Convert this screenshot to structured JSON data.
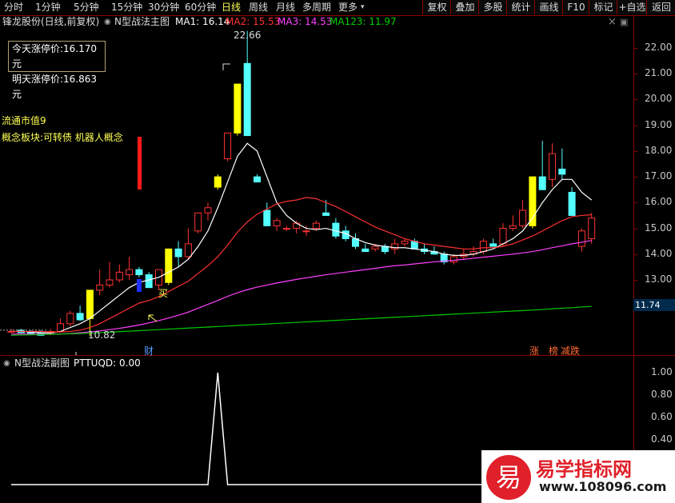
{
  "stock_title": "锋龙股份(日线,前复权)",
  "period_tabs": [
    {
      "label": "分时"
    },
    {
      "label": "1分钟"
    },
    {
      "label": "5分钟"
    },
    {
      "label": "15分钟"
    },
    {
      "label": "30分钟"
    },
    {
      "label": "60分钟"
    },
    {
      "label": "日线"
    },
    {
      "label": "周线"
    },
    {
      "label": "月线"
    },
    {
      "label": "多周期"
    },
    {
      "label": "更多"
    }
  ],
  "active_period": "日线",
  "right_buttons": [
    {
      "label": "复权"
    },
    {
      "label": "叠加"
    },
    {
      "label": "多股"
    },
    {
      "label": "统计"
    },
    {
      "label": "画线"
    },
    {
      "label": "F10"
    },
    {
      "label": "标记"
    },
    {
      "label": "+自选"
    },
    {
      "label": "返回"
    }
  ],
  "main_indicator": {
    "name": "N型战法主图",
    "ma1": "MA1: 16.14",
    "ma2": "MA2: 15.53",
    "ma3": "MA3: 14.53",
    "ma123": "MA123: 11.97"
  },
  "price_box": {
    "today_limit": "今天涨停价:16.170元",
    "tomorrow_limit": "明天涨停价:16.863元"
  },
  "float_cap": "流通市值9",
  "concepts": "概念板块:可转债 机器人概念",
  "annotations": {
    "high_label": "22.66",
    "low_label": "10.82",
    "buy_label": "买",
    "finance_marker": "财",
    "zhang_marker": "涨",
    "bang_marker": "榜",
    "jiandie_marker": "减跌"
  },
  "y_axis_ticks": [
    "22.00",
    "21.00",
    "20.00",
    "19.00",
    "18.00",
    "17.00",
    "16.00",
    "15.00",
    "14.00",
    "13.00"
  ],
  "current_price_tag": "11.74",
  "sub_indicator": {
    "name": "N型战法副图",
    "value": "PTTUQD: 0.00"
  },
  "sub_y_ticks": [
    "1.00",
    "0.80",
    "0.60",
    "0.40"
  ],
  "colors": {
    "up": "#ff3232",
    "down": "#54ffff",
    "limit": "#ffff00",
    "ma1": "#ffffff",
    "ma2": "#ff3030",
    "ma3": "#ff40ff",
    "ma123": "#00c800"
  },
  "watermark": {
    "logo_char": "易",
    "title": "易学指标网",
    "url": "www.108096.com"
  },
  "chart_data": {
    "type": "candlestick",
    "candles": [
      {
        "o": 11.0,
        "h": 11.1,
        "l": 10.95,
        "c": 11.0
      },
      {
        "o": 11.05,
        "h": 11.1,
        "l": 10.95,
        "c": 10.95
      },
      {
        "o": 11.0,
        "h": 11.05,
        "l": 10.9,
        "c": 10.9
      },
      {
        "o": 10.95,
        "h": 11.05,
        "l": 10.85,
        "c": 10.85
      },
      {
        "o": 10.9,
        "h": 11.1,
        "l": 10.85,
        "c": 11.0
      },
      {
        "o": 11.0,
        "h": 11.5,
        "l": 10.95,
        "c": 11.3
      },
      {
        "o": 11.3,
        "h": 11.8,
        "l": 11.2,
        "c": 11.7
      },
      {
        "o": 11.7,
        "h": 12.0,
        "l": 11.4,
        "c": 11.45
      },
      {
        "o": 11.5,
        "h": 12.6,
        "l": 10.82,
        "c": 12.6
      },
      {
        "o": 12.6,
        "h": 13.4,
        "l": 12.4,
        "c": 12.8
      },
      {
        "o": 12.8,
        "h": 13.7,
        "l": 12.7,
        "c": 13.0
      },
      {
        "o": 13.0,
        "h": 13.6,
        "l": 12.9,
        "c": 13.3
      },
      {
        "o": 13.2,
        "h": 13.9,
        "l": 13.0,
        "c": 13.4
      },
      {
        "o": 13.4,
        "h": 13.5,
        "l": 13.1,
        "c": 13.2
      },
      {
        "o": 13.2,
        "h": 13.3,
        "l": 12.7,
        "c": 12.7
      },
      {
        "o": 12.8,
        "h": 13.4,
        "l": 12.6,
        "c": 13.4
      },
      {
        "o": 12.9,
        "h": 14.2,
        "l": 12.8,
        "c": 14.2
      },
      {
        "o": 14.2,
        "h": 14.5,
        "l": 13.5,
        "c": 13.9
      },
      {
        "o": 13.9,
        "h": 15.0,
        "l": 13.8,
        "c": 14.4
      },
      {
        "o": 14.9,
        "h": 15.6,
        "l": 14.8,
        "c": 15.6
      },
      {
        "o": 15.6,
        "h": 16.0,
        "l": 15.3,
        "c": 15.8
      },
      {
        "o": 16.6,
        "h": 17.1,
        "l": 16.5,
        "c": 17.0
      },
      {
        "o": 17.7,
        "h": 18.7,
        "l": 17.6,
        "c": 18.7
      },
      {
        "o": 18.7,
        "h": 20.6,
        "l": 18.6,
        "c": 20.6
      },
      {
        "o": 21.4,
        "h": 22.66,
        "l": 18.6,
        "c": 18.6
      },
      {
        "o": 17.0,
        "h": 17.1,
        "l": 16.8,
        "c": 16.8
      },
      {
        "o": 15.7,
        "h": 16.0,
        "l": 15.1,
        "c": 15.1
      },
      {
        "o": 15.1,
        "h": 15.4,
        "l": 14.9,
        "c": 15.3
      },
      {
        "o": 15.0,
        "h": 15.1,
        "l": 14.9,
        "c": 15.0
      },
      {
        "o": 15.0,
        "h": 15.3,
        "l": 14.8,
        "c": 15.2
      },
      {
        "o": 14.9,
        "h": 15.1,
        "l": 14.7,
        "c": 14.9
      },
      {
        "o": 15.0,
        "h": 15.3,
        "l": 14.9,
        "c": 15.2
      },
      {
        "o": 15.6,
        "h": 16.1,
        "l": 15.5,
        "c": 15.5
      },
      {
        "o": 15.2,
        "h": 15.4,
        "l": 14.6,
        "c": 14.7
      },
      {
        "o": 14.9,
        "h": 15.1,
        "l": 14.5,
        "c": 14.6
      },
      {
        "o": 14.6,
        "h": 14.8,
        "l": 14.2,
        "c": 14.3
      },
      {
        "o": 14.2,
        "h": 14.4,
        "l": 14.1,
        "c": 14.1
      },
      {
        "o": 14.2,
        "h": 14.4,
        "l": 14.1,
        "c": 14.3
      },
      {
        "o": 14.3,
        "h": 14.4,
        "l": 14.0,
        "c": 14.1
      },
      {
        "o": 14.2,
        "h": 14.6,
        "l": 14.0,
        "c": 14.4
      },
      {
        "o": 14.4,
        "h": 14.6,
        "l": 14.3,
        "c": 14.5
      },
      {
        "o": 14.5,
        "h": 14.6,
        "l": 14.2,
        "c": 14.2
      },
      {
        "o": 14.2,
        "h": 14.4,
        "l": 14.0,
        "c": 14.1
      },
      {
        "o": 14.1,
        "h": 14.3,
        "l": 14.0,
        "c": 14.0
      },
      {
        "o": 14.0,
        "h": 14.1,
        "l": 13.6,
        "c": 13.7
      },
      {
        "o": 13.7,
        "h": 14.0,
        "l": 13.6,
        "c": 13.9
      },
      {
        "o": 13.9,
        "h": 14.2,
        "l": 13.8,
        "c": 14.0
      },
      {
        "o": 14.0,
        "h": 14.3,
        "l": 13.9,
        "c": 14.1
      },
      {
        "o": 14.1,
        "h": 14.6,
        "l": 14.0,
        "c": 14.5
      },
      {
        "o": 14.4,
        "h": 14.6,
        "l": 14.3,
        "c": 14.3
      },
      {
        "o": 14.4,
        "h": 15.2,
        "l": 14.3,
        "c": 15.0
      },
      {
        "o": 15.0,
        "h": 15.5,
        "l": 14.9,
        "c": 15.1
      },
      {
        "o": 15.1,
        "h": 16.1,
        "l": 15.0,
        "c": 15.7
      },
      {
        "o": 15.1,
        "h": 17.0,
        "l": 15.0,
        "c": 17.0
      },
      {
        "o": 17.0,
        "h": 18.4,
        "l": 16.7,
        "c": 16.5
      },
      {
        "o": 16.9,
        "h": 18.3,
        "l": 16.6,
        "c": 17.9
      },
      {
        "o": 17.3,
        "h": 18.1,
        "l": 16.9,
        "c": 17.1
      },
      {
        "o": 16.4,
        "h": 16.6,
        "l": 15.5,
        "c": 15.5
      },
      {
        "o": 14.3,
        "h": 15.0,
        "l": 14.1,
        "c": 14.9
      },
      {
        "o": 14.6,
        "h": 15.6,
        "l": 14.4,
        "c": 15.4
      }
    ],
    "limit_up_indices": [
      8,
      16,
      21,
      23,
      53
    ],
    "ma1": [
      11.0,
      11.0,
      10.98,
      10.95,
      10.94,
      11.0,
      11.15,
      11.3,
      11.5,
      11.8,
      12.1,
      12.4,
      12.7,
      12.9,
      13.0,
      13.1,
      13.3,
      13.5,
      13.8,
      14.3,
      14.9,
      15.8,
      16.8,
      17.8,
      18.3,
      18.0,
      17.0,
      16.0,
      15.5,
      15.2,
      15.0,
      14.95,
      15.0,
      14.9,
      14.8,
      14.6,
      14.45,
      14.35,
      14.3,
      14.25,
      14.25,
      14.2,
      14.15,
      14.1,
      14.0,
      13.95,
      13.95,
      14.0,
      14.1,
      14.2,
      14.4,
      14.6,
      14.9,
      15.4,
      16.0,
      16.5,
      16.9,
      16.9,
      16.4,
      16.1
    ],
    "ma2": [
      11.0,
      11.0,
      11.0,
      11.0,
      10.98,
      10.98,
      11.0,
      11.05,
      11.15,
      11.3,
      11.5,
      11.7,
      11.9,
      12.1,
      12.2,
      12.35,
      12.55,
      12.75,
      12.95,
      13.25,
      13.55,
      13.9,
      14.35,
      14.85,
      15.25,
      15.55,
      15.75,
      15.95,
      16.05,
      16.1,
      16.2,
      16.15,
      16.0,
      15.85,
      15.65,
      15.45,
      15.25,
      15.05,
      14.9,
      14.75,
      14.6,
      14.5,
      14.4,
      14.35,
      14.3,
      14.25,
      14.2,
      14.2,
      14.25,
      14.25,
      14.3,
      14.4,
      14.55,
      14.7,
      14.9,
      15.1,
      15.3,
      15.45,
      15.5,
      15.53
    ],
    "ma3": [
      10.9,
      10.9,
      10.9,
      10.9,
      10.9,
      10.9,
      10.92,
      10.95,
      10.98,
      11.02,
      11.07,
      11.12,
      11.18,
      11.25,
      11.33,
      11.42,
      11.52,
      11.63,
      11.75,
      11.9,
      12.05,
      12.2,
      12.36,
      12.5,
      12.62,
      12.72,
      12.8,
      12.88,
      12.95,
      13.02,
      13.08,
      13.14,
      13.2,
      13.25,
      13.3,
      13.35,
      13.4,
      13.45,
      13.5,
      13.55,
      13.58,
      13.62,
      13.66,
      13.7,
      13.73,
      13.76,
      13.8,
      13.84,
      13.88,
      13.92,
      13.96,
      14.0,
      14.05,
      14.1,
      14.17,
      14.25,
      14.32,
      14.4,
      14.46,
      14.53
    ],
    "ma123": [
      10.85,
      10.86,
      10.87,
      10.88,
      10.89,
      10.9,
      10.91,
      10.92,
      10.93,
      10.95,
      10.97,
      10.99,
      11.01,
      11.03,
      11.05,
      11.07,
      11.09,
      11.11,
      11.13,
      11.15,
      11.17,
      11.19,
      11.21,
      11.23,
      11.25,
      11.27,
      11.29,
      11.31,
      11.33,
      11.35,
      11.37,
      11.39,
      11.41,
      11.43,
      11.45,
      11.47,
      11.49,
      11.51,
      11.53,
      11.55,
      11.57,
      11.59,
      11.61,
      11.63,
      11.65,
      11.67,
      11.69,
      11.71,
      11.73,
      11.75,
      11.77,
      11.79,
      11.81,
      11.83,
      11.85,
      11.88,
      11.9,
      11.92,
      11.95,
      11.97
    ],
    "pttuqd": [
      0,
      0,
      0,
      0,
      0,
      0,
      0,
      0,
      0,
      0,
      0,
      0,
      0,
      0,
      0,
      0,
      0,
      0,
      0,
      0,
      0,
      1,
      0,
      0,
      0,
      0,
      0,
      0,
      0,
      0,
      0,
      0,
      0,
      0,
      0,
      0,
      0,
      0,
      0,
      0,
      0,
      0,
      0,
      0,
      0,
      0,
      0,
      0,
      0,
      0,
      0,
      0,
      0,
      0,
      0,
      0,
      0,
      0,
      0,
      0
    ],
    "ylim": [
      12.0,
      23.0
    ],
    "sub_ylim": [
      0,
      1.0
    ]
  }
}
